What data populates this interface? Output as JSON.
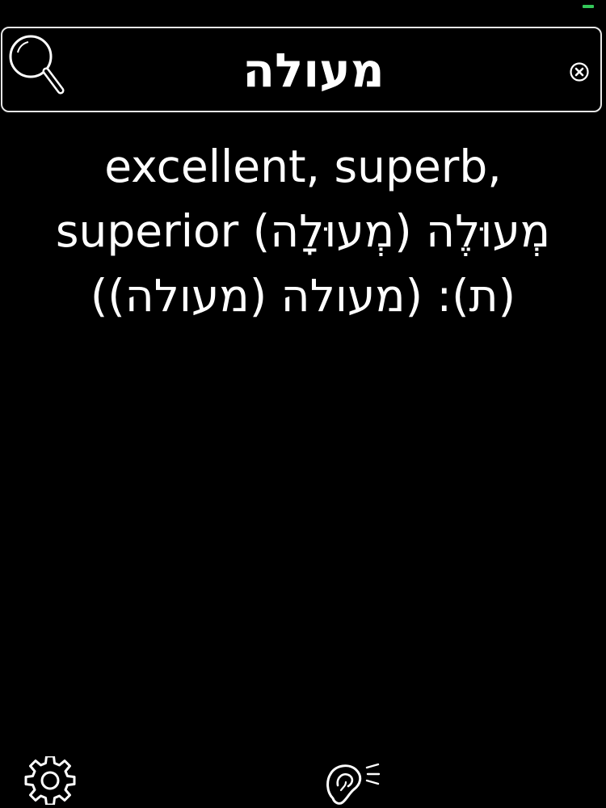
{
  "search": {
    "query": "מעולה"
  },
  "result": {
    "definition": "excellent, superb, superior מְעוּלֶה (מְעוּלָה) (ת): (מעולה (מעולה))"
  },
  "icons": {
    "search": "search-icon",
    "clear": "clear-icon",
    "settings": "gear-icon",
    "listen": "ear-icon"
  },
  "colors": {
    "background": "#000000",
    "text": "#ffffff",
    "border": "#e6e6e6",
    "battery": "#34c759"
  }
}
